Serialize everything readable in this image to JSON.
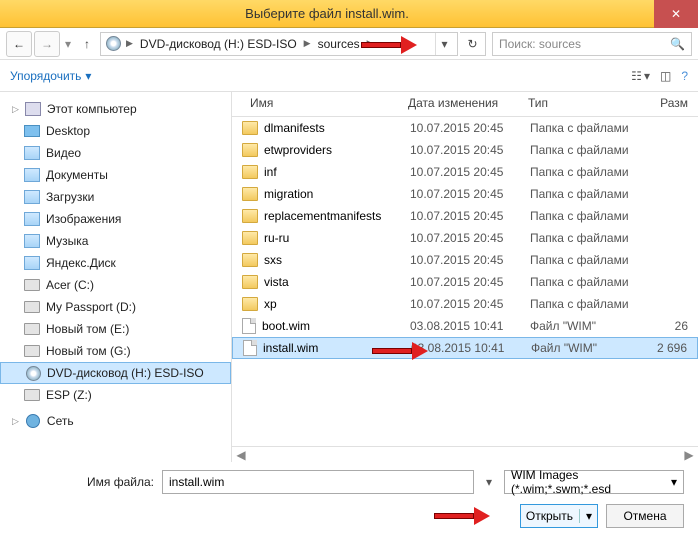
{
  "title": "Выберите файл install.wim.",
  "breadcrumb": {
    "item1": "DVD-дисковод (H:) ESD-ISO",
    "item2": "sources"
  },
  "search_placeholder": "Поиск: sources",
  "organize_label": "Упорядочить",
  "columns": {
    "name": "Имя",
    "date": "Дата изменения",
    "type": "Тип",
    "size": "Разм"
  },
  "sidebar": {
    "root": "Этот компьютер",
    "items": [
      {
        "label": "Desktop",
        "icon": "desk"
      },
      {
        "label": "Видео",
        "icon": "lib"
      },
      {
        "label": "Документы",
        "icon": "lib"
      },
      {
        "label": "Загрузки",
        "icon": "lib"
      },
      {
        "label": "Изображения",
        "icon": "lib"
      },
      {
        "label": "Музыка",
        "icon": "lib"
      },
      {
        "label": "Яндекс.Диск",
        "icon": "lib"
      },
      {
        "label": "Acer (C:)",
        "icon": "drive"
      },
      {
        "label": "My Passport (D:)",
        "icon": "drive"
      },
      {
        "label": "Новый том (E:)",
        "icon": "drive"
      },
      {
        "label": "Новый том (G:)",
        "icon": "drive"
      },
      {
        "label": "DVD-дисковод (H:) ESD-ISO",
        "icon": "disc",
        "selected": true
      },
      {
        "label": "ESP (Z:)",
        "icon": "drive"
      }
    ],
    "network": "Сеть"
  },
  "files": [
    {
      "name": "dlmanifests",
      "date": "10.07.2015 20:45",
      "type": "Папка с файлами",
      "size": "",
      "folder": true
    },
    {
      "name": "etwproviders",
      "date": "10.07.2015 20:45",
      "type": "Папка с файлами",
      "size": "",
      "folder": true
    },
    {
      "name": "inf",
      "date": "10.07.2015 20:45",
      "type": "Папка с файлами",
      "size": "",
      "folder": true
    },
    {
      "name": "migration",
      "date": "10.07.2015 20:45",
      "type": "Папка с файлами",
      "size": "",
      "folder": true
    },
    {
      "name": "replacementmanifests",
      "date": "10.07.2015 20:45",
      "type": "Папка с файлами",
      "size": "",
      "folder": true
    },
    {
      "name": "ru-ru",
      "date": "10.07.2015 20:45",
      "type": "Папка с файлами",
      "size": "",
      "folder": true
    },
    {
      "name": "sxs",
      "date": "10.07.2015 20:45",
      "type": "Папка с файлами",
      "size": "",
      "folder": true
    },
    {
      "name": "vista",
      "date": "10.07.2015 20:45",
      "type": "Папка с файлами",
      "size": "",
      "folder": true
    },
    {
      "name": "xp",
      "date": "10.07.2015 20:45",
      "type": "Папка с файлами",
      "size": "",
      "folder": true
    },
    {
      "name": "boot.wim",
      "date": "03.08.2015 10:41",
      "type": "Файл \"WIM\"",
      "size": "26",
      "folder": false
    },
    {
      "name": "install.wim",
      "date": "03.08.2015 10:41",
      "type": "Файл \"WIM\"",
      "size": "2 696",
      "folder": false,
      "selected": true
    }
  ],
  "filename_label": "Имя файла:",
  "filename_value": "install.wim",
  "filter_label": "WIM Images (*.wim;*.swm;*.esd",
  "open_label": "Открыть",
  "cancel_label": "Отмена"
}
